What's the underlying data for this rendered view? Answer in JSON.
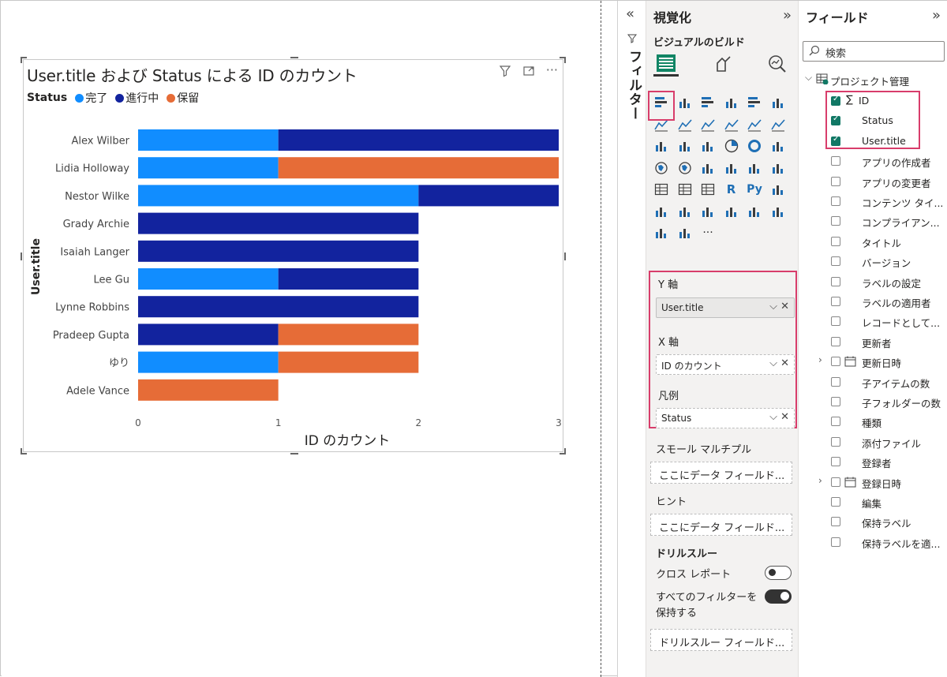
{
  "colors": {
    "complete": "#118dff",
    "inprogress": "#12239e",
    "hold": "#e66c37",
    "accent_red": "#d83d6b"
  },
  "visual": {
    "title": "User.title および Status による ID のカウント",
    "legend_title": "Status",
    "legend": [
      "完了",
      "進行中",
      "保留"
    ],
    "icons": [
      "filter-icon",
      "focus-mode-icon",
      "more-options-icon"
    ]
  },
  "chart_data": {
    "type": "bar",
    "orientation": "horizontal-stacked",
    "categories": [
      "Alex Wilber",
      "Lidia Holloway",
      "Nestor Wilke",
      "Grady Archie",
      "Isaiah Langer",
      "Lee Gu",
      "Lynne Robbins",
      "Pradeep Gupta",
      "ゆり",
      "Adele Vance"
    ],
    "series": [
      {
        "name": "完了",
        "values": [
          1,
          1,
          2,
          0,
          0,
          1,
          0,
          0,
          1,
          0
        ]
      },
      {
        "name": "進行中",
        "values": [
          2,
          0,
          1,
          2,
          2,
          1,
          2,
          1,
          0,
          0
        ]
      },
      {
        "name": "保留",
        "values": [
          0,
          2,
          0,
          0,
          0,
          0,
          0,
          1,
          1,
          1
        ]
      }
    ],
    "xlabel": "ID のカウント",
    "ylabel": "User.title",
    "xlim": [
      0,
      3
    ],
    "xticks": [
      "0",
      "1",
      "2",
      "3"
    ],
    "legend": "top-left"
  },
  "filter_pane": {
    "label": "フィルター",
    "collapse_icon": "«"
  },
  "viz_pane": {
    "title": "視覚化",
    "expand_icon": "»",
    "subtitle": "ビジュアルのビルド",
    "y_axis_label": "Y 軸",
    "y_axis_value": "User.title",
    "x_axis_label": "X 軸",
    "x_axis_value": "ID のカウント",
    "legend_label": "凡例",
    "legend_value": "Status",
    "small_multiples_label": "スモール マルチプル",
    "drop_placeholder": "ここにデータ フィールド...",
    "tooltip_label": "ヒント",
    "drop_placeholder2": "ここにデータ フィールド...",
    "drillthrough_label": "ドリルスルー",
    "cross_report_label": "クロス レポート",
    "cross_report_state": "オフ",
    "keep_filters_label1": "すべてのフィルターを",
    "keep_filters_label2": "保持する",
    "keep_filters_state": "オン",
    "drill_placeholder": "ドリルスルー フィールド...",
    "more": "···"
  },
  "fields_pane": {
    "title": "フィールド",
    "expand_icon": "»",
    "search_placeholder": "検索",
    "table_name": "プロジェクト管理",
    "fields": [
      {
        "name": "ID",
        "checked": true,
        "sigma": true
      },
      {
        "name": "Status",
        "checked": true
      },
      {
        "name": "User.title",
        "checked": true
      },
      {
        "name": "アプリの作成者",
        "checked": false
      },
      {
        "name": "アプリの変更者",
        "checked": false
      },
      {
        "name": "コンテンツ タイ...",
        "checked": false
      },
      {
        "name": "コンプライアン...",
        "checked": false
      },
      {
        "name": "タイトル",
        "checked": false
      },
      {
        "name": "バージョン",
        "checked": false
      },
      {
        "name": "ラベルの設定",
        "checked": false
      },
      {
        "name": "ラベルの適用者",
        "checked": false
      },
      {
        "name": "レコードとして...",
        "checked": false
      },
      {
        "name": "更新者",
        "checked": false
      },
      {
        "name": "更新日時",
        "checked": false,
        "date": true
      },
      {
        "name": "子アイテムの数",
        "checked": false
      },
      {
        "name": "子フォルダーの数",
        "checked": false
      },
      {
        "name": "種類",
        "checked": false
      },
      {
        "name": "添付ファイル",
        "checked": false
      },
      {
        "name": "登録者",
        "checked": false
      },
      {
        "name": "登録日時",
        "checked": false,
        "date": true
      },
      {
        "name": "編集",
        "checked": false
      },
      {
        "name": "保持ラベル",
        "checked": false
      },
      {
        "name": "保持ラベルを適...",
        "checked": false
      }
    ]
  }
}
